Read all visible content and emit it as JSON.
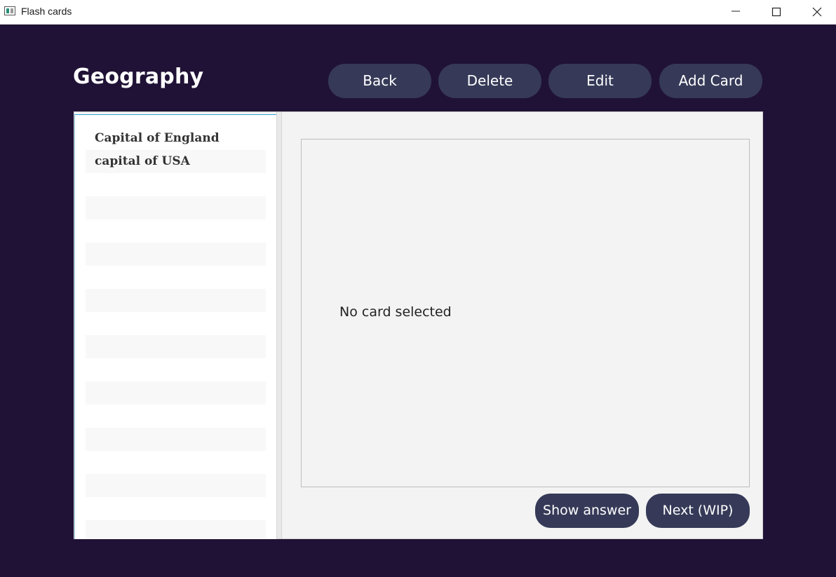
{
  "window": {
    "title": "Flash cards"
  },
  "header": {
    "deck_title": "Geography",
    "buttons": {
      "back": "Back",
      "delete": "Delete",
      "edit": "Edit",
      "add_card": "Add Card"
    }
  },
  "card_list": {
    "items": [
      {
        "label": "Capital of England"
      },
      {
        "label": "capital of USA"
      }
    ]
  },
  "card_view": {
    "text": "No card selected"
  },
  "footer": {
    "show_answer": "Show answer",
    "next": "Next (WIP)"
  },
  "colors": {
    "background": "#201236",
    "button": "#363a58",
    "panel": "#f3f3f3",
    "list_accent": "#2ea3d6"
  },
  "icons": {
    "app": "flash-cards-app-icon",
    "minimize": "minimize-icon",
    "maximize": "maximize-icon",
    "close": "close-icon"
  }
}
